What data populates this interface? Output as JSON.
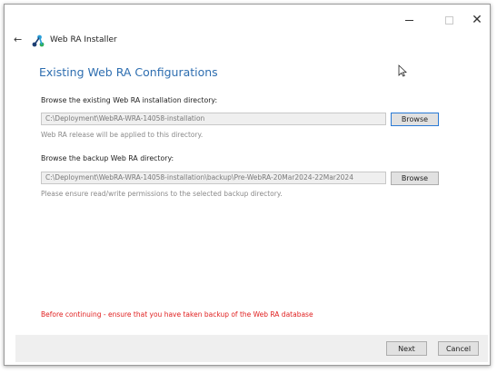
{
  "window": {
    "title": "Web RA Installer",
    "controls": {
      "minimize": "minimize-icon",
      "maximize": "maximize-icon",
      "close": "close-icon"
    },
    "accent_color": "#2e6eb0"
  },
  "page": {
    "title": "Existing Web RA Configurations"
  },
  "install_dir": {
    "label": "Browse the existing Web RA installation directory:",
    "value": "C:\\Deployment\\WebRA-WRA-14058-installation",
    "hint": "Web RA release will be applied to this directory.",
    "browse_label": "Browse"
  },
  "backup_dir": {
    "label": "Browse the backup Web RA directory:",
    "value": "C:\\Deployment\\WebRA-WRA-14058-installation\\backup\\Pre-WebRA-20Mar2024-22Mar2024",
    "hint": "Please ensure read/write permissions to the selected backup directory.",
    "browse_label": "Browse"
  },
  "warning": {
    "text": "Before continuing - ensure that you have taken backup of the Web RA database",
    "color": "#e02020"
  },
  "footer": {
    "next_label": "Next",
    "cancel_label": "Cancel"
  }
}
